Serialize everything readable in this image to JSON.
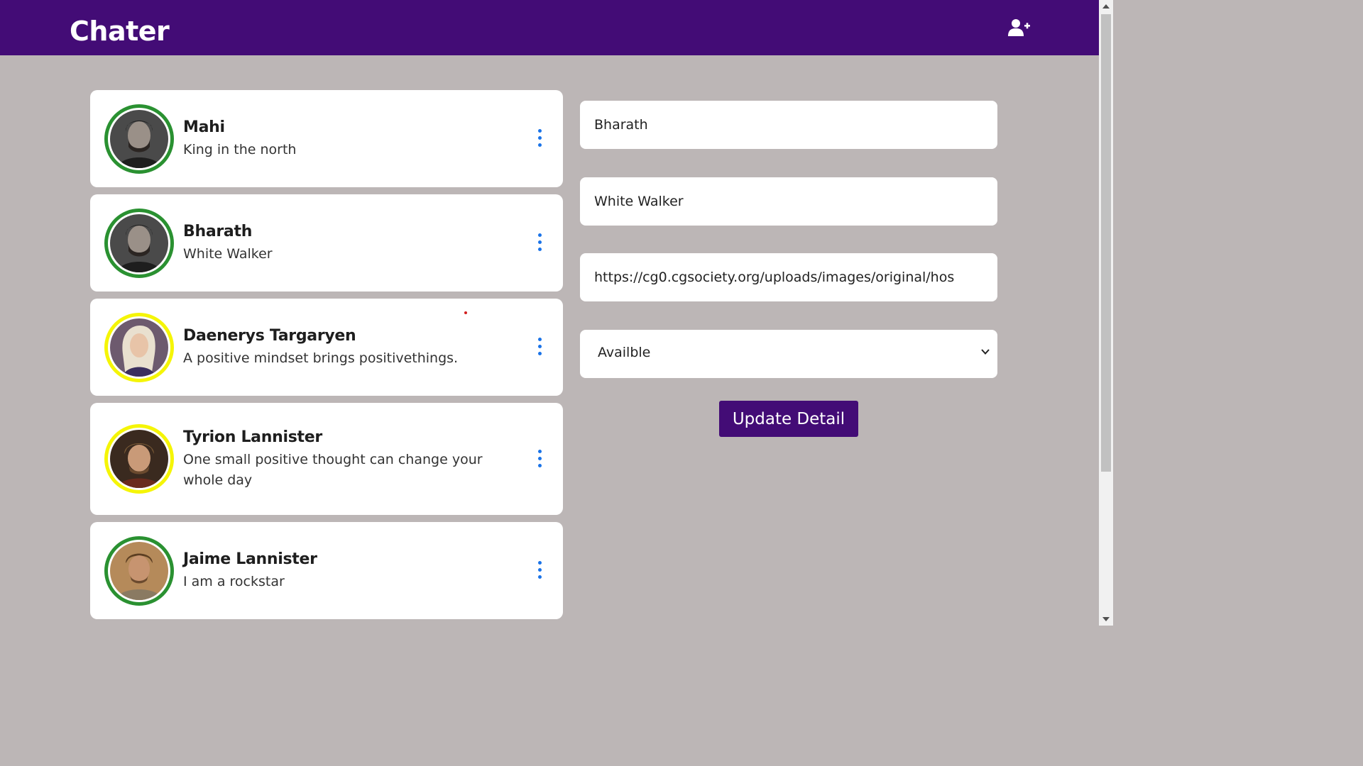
{
  "app": {
    "brand": "Chater",
    "add_user_icon": "add-user-icon"
  },
  "colors": {
    "header": "#430c76",
    "background": "#bcb6b6",
    "online": "#2a9131",
    "away": "#f5f507",
    "menu_dots": "#1a73e8"
  },
  "contacts": [
    {
      "name": "Mahi",
      "status_text": "King in the north",
      "presence": "online"
    },
    {
      "name": "Bharath",
      "status_text": "White Walker",
      "presence": "online"
    },
    {
      "name": "Daenerys Targaryen",
      "status_text": "A positive mindset brings positivethings.",
      "presence": "away"
    },
    {
      "name": "Tyrion Lannister",
      "status_text": "One small positive thought can change your whole day",
      "presence": "away"
    },
    {
      "name": "Jaime Lannister",
      "status_text": "I am a rockstar",
      "presence": "online"
    }
  ],
  "form": {
    "name_value": "Bharath",
    "status_value": "White Walker",
    "image_url_value": "https://cg0.cgsociety.org/uploads/images/original/hos",
    "availability_value": "Availble",
    "submit_label": "Update Detail"
  }
}
